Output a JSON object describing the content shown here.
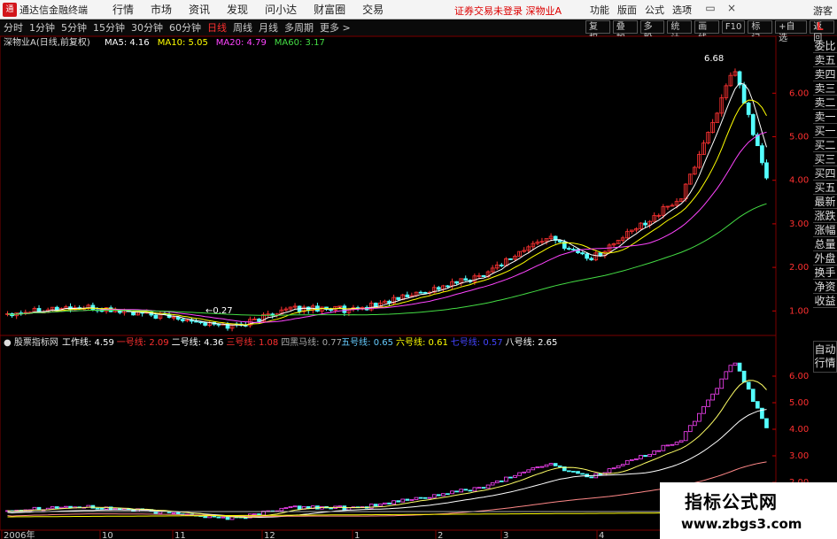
{
  "app": {
    "title": "通达信金融终端",
    "logo": "通",
    "warning": "证券交易未登录  深物业A",
    "guest": "游客",
    "menu": [
      "行情",
      "市场",
      "资讯",
      "发现",
      "问小达",
      "财富圈",
      "交易"
    ],
    "right_menu": [
      "功能",
      "版面",
      "公式",
      "选项"
    ],
    "win_controls": [
      "–",
      "▭",
      "×"
    ]
  },
  "toolbar": {
    "periods": [
      "分时",
      "1分钟",
      "5分钟",
      "15分钟",
      "30分钟",
      "60分钟",
      "日线",
      "周线",
      "月线",
      "多周期",
      "更多 >"
    ],
    "active": "日线",
    "buttons": [
      "复权",
      "叠加",
      "多股",
      "统计",
      "画线",
      "F10",
      "标记",
      "+自选",
      "返回"
    ],
    "mark": "L"
  },
  "sidebar": {
    "items": [
      "委比",
      "卖五",
      "卖四",
      "卖三",
      "卖二",
      "卖一",
      "买一",
      "买二",
      "买三",
      "买四",
      "买五",
      "最新",
      "涨跌",
      "涨幅",
      "总量",
      "外盘",
      "换手",
      "净资",
      "收益"
    ],
    "items2": [
      "自动",
      "行情"
    ]
  },
  "watermark": {
    "line1": "指标公式网",
    "line2": "www.zbgs3.com"
  },
  "main_legend": {
    "title": "深物业A(日线,前复权)",
    "items": [
      {
        "t": "MA5: 4.16",
        "c": "#ffffff"
      },
      {
        "t": "MA10: 5.05",
        "c": "#ffff00"
      },
      {
        "t": "MA20: 4.79",
        "c": "#ff44ff"
      },
      {
        "t": "MA60: 3.17",
        "c": "#44dd44"
      }
    ]
  },
  "sub_legend": {
    "title": "股票指标网",
    "items": [
      {
        "t": "工作线: 4.59",
        "c": "#ffffff"
      },
      {
        "t": "一号线: 2.09",
        "c": "#ff3030"
      },
      {
        "t": "二号线: 4.36",
        "c": "#ffffff"
      },
      {
        "t": "三号线: 1.08",
        "c": "#ff3030"
      },
      {
        "t": "四黑马线: 0.77",
        "c": "#aaaaaa"
      },
      {
        "t": "五号线: 0.65",
        "c": "#66ccff"
      },
      {
        "t": "六号线: 0.61",
        "c": "#ffff00"
      },
      {
        "t": "七号线: 0.57",
        "c": "#4444ff"
      },
      {
        "t": "八号线: 2.65",
        "c": "#ffffff"
      }
    ]
  },
  "main_axis": [
    "6.00",
    "5.00",
    "4.00",
    "3.00",
    "2.00",
    "1.00"
  ],
  "sub_axis": [
    "6.00",
    "5.00",
    "4.00",
    "3.00",
    "2.00"
  ],
  "annotations": {
    "high": "6.68",
    "low": "←0.27"
  },
  "dates": [
    "2006年",
    "10",
    "11",
    "12",
    "1",
    "2",
    "3",
    "4"
  ],
  "colors": {
    "up": "#ff3232",
    "down": "#54ffff",
    "ma5": "#ffffff",
    "ma10": "#ffff00",
    "ma20": "#ff44ff",
    "ma60": "#44dd44"
  }
}
